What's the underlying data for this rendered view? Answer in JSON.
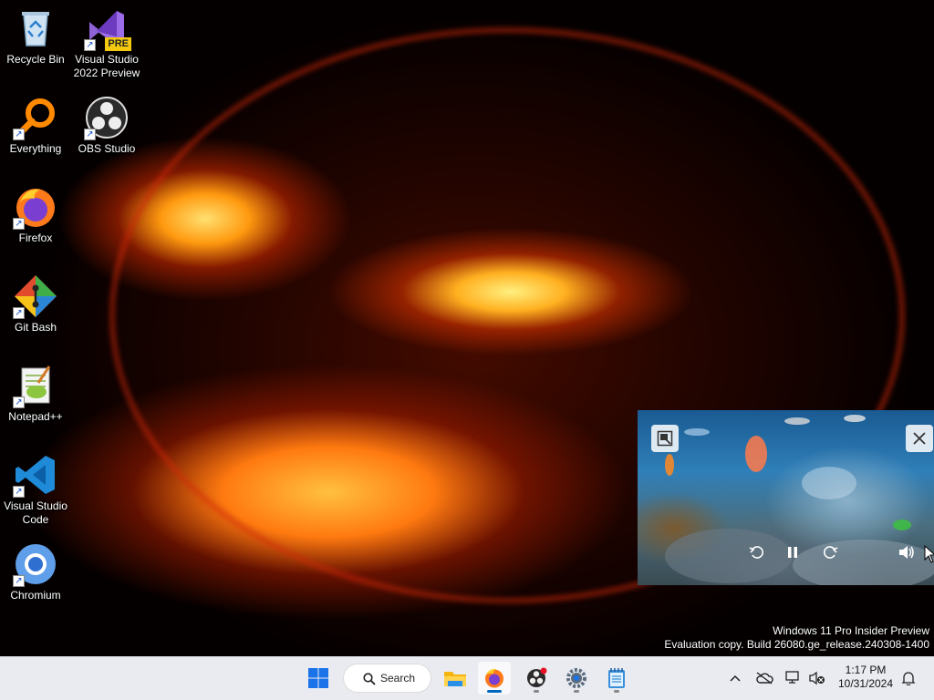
{
  "desktop": {
    "icons": [
      {
        "label": "Recycle Bin",
        "icon": "recycle-bin-icon"
      },
      {
        "label": "Visual Studio 2022 Preview",
        "icon": "visual-studio-preview-icon",
        "badge": "PRE"
      },
      {
        "label": "Everything",
        "icon": "everything-search-icon"
      },
      {
        "label": "OBS Studio",
        "icon": "obs-studio-icon"
      },
      {
        "label": "Firefox",
        "icon": "firefox-icon"
      },
      {
        "label": "Git Bash",
        "icon": "git-bash-icon"
      },
      {
        "label": "Notepad++",
        "icon": "notepad-plus-plus-icon"
      },
      {
        "label": "Visual Studio Code",
        "icon": "vscode-icon"
      },
      {
        "label": "Chromium",
        "icon": "chromium-icon"
      }
    ]
  },
  "watermark": {
    "line1": "Windows 11 Pro Insider Preview",
    "line2": "Evaluation copy. Build 26080.ge_release.240308-1400"
  },
  "pip": {
    "controls": [
      "back-to-tab-icon",
      "close-icon",
      "rewind-icon",
      "pause-icon",
      "forward-icon",
      "volume-icon"
    ]
  },
  "taskbar": {
    "search_label": "Search",
    "apps": [
      "start-icon",
      "file-explorer-icon",
      "firefox-icon",
      "obs-studio-icon",
      "settings-icon",
      "notepad-icon"
    ],
    "accent": "#0067c0"
  },
  "tray": {
    "time": "1:17 PM",
    "date": "10/31/2024"
  }
}
